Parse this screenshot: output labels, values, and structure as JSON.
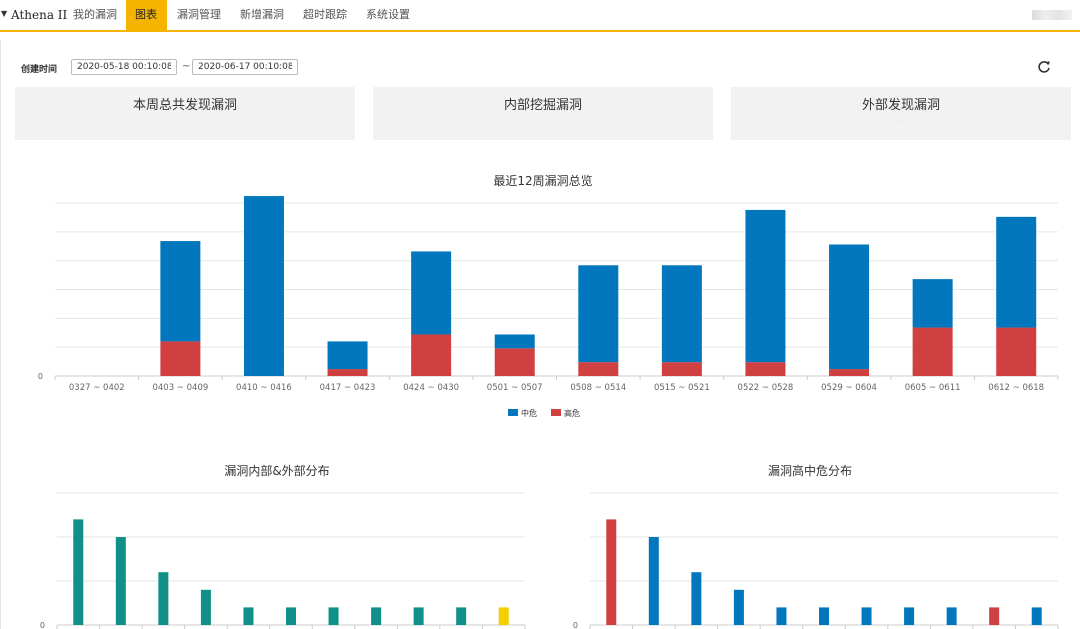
{
  "nav": {
    "brand": "Athena II",
    "items": [
      {
        "label": "我的漏洞",
        "active": false
      },
      {
        "label": "图表",
        "active": true
      },
      {
        "label": "漏洞管理",
        "active": false
      },
      {
        "label": "新增漏洞",
        "active": false
      },
      {
        "label": "超时跟踪",
        "active": false
      },
      {
        "label": "系统设置",
        "active": false
      }
    ]
  },
  "filter": {
    "label": "创建时间",
    "start": "2020-05-18 00:10:08",
    "separator": "~",
    "end": "2020-06-17 00:10:08"
  },
  "cards": [
    {
      "title": "本周总共发现漏洞",
      "value": "—"
    },
    {
      "title": "内部挖掘漏洞",
      "value": "—"
    },
    {
      "title": "外部发现漏洞",
      "value": "—"
    }
  ],
  "colors": {
    "accent": "#f5b400",
    "medium": "#0277bd",
    "high": "#d04040",
    "teal": "#109088",
    "yellow": "#f5d000"
  },
  "chart_data": [
    {
      "type": "bar",
      "stacked": true,
      "title": "最近12周漏洞总览",
      "categories": [
        "0327 ~ 0402",
        "0403 ~ 0409",
        "0410 ~ 0416",
        "0417 ~ 0423",
        "0424 ~ 0430",
        "0501 ~ 0507",
        "0508 ~ 0514",
        "0515 ~ 0521",
        "0522 ~ 0528",
        "0529 ~ 0604",
        "0605 ~ 0611",
        "0612 ~ 0618"
      ],
      "series": [
        {
          "name": "高危",
          "color": "#d04040",
          "values": [
            0,
            1.0,
            0,
            0.2,
            1.2,
            0.8,
            0.4,
            0.4,
            0.4,
            0.2,
            1.4,
            1.4
          ]
        },
        {
          "name": "中危",
          "color": "#0277bd",
          "values": [
            0,
            2.9,
            5.2,
            0.8,
            2.4,
            0.4,
            2.8,
            2.8,
            4.4,
            3.6,
            1.4,
            3.2
          ]
        }
      ],
      "yticks": [
        "0"
      ],
      "ylim": [
        0,
        5
      ],
      "legend_position": "bottom",
      "grid": true
    },
    {
      "type": "bar",
      "title": "漏洞内部&外部分布",
      "values": [
        2.4,
        2.0,
        1.2,
        0.8,
        0.4,
        0.4,
        0.4,
        0.4,
        0.4,
        0.4,
        0.4
      ],
      "colors": [
        "#109088",
        "#109088",
        "#109088",
        "#109088",
        "#109088",
        "#109088",
        "#109088",
        "#109088",
        "#109088",
        "#109088",
        "#f5d000"
      ],
      "yticks": [
        "0"
      ],
      "ylim": [
        0,
        3
      ],
      "grid": true
    },
    {
      "type": "bar",
      "title": "漏洞高中危分布",
      "values": [
        2.4,
        2.0,
        1.2,
        0.8,
        0.4,
        0.4,
        0.4,
        0.4,
        0.4,
        0.4,
        0.4
      ],
      "colors": [
        "#d04040",
        "#0277bd",
        "#0277bd",
        "#0277bd",
        "#0277bd",
        "#0277bd",
        "#0277bd",
        "#0277bd",
        "#0277bd",
        "#d04040",
        "#0277bd"
      ],
      "yticks": [
        "0"
      ],
      "ylim": [
        0,
        3
      ],
      "grid": true
    }
  ]
}
